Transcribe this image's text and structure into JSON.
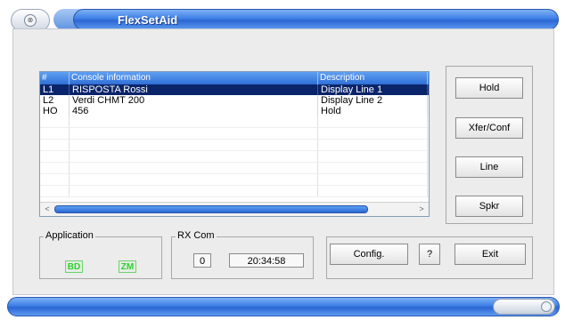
{
  "window": {
    "title": "FlexSetAid"
  },
  "list": {
    "columns": [
      "#",
      "Console information",
      "Description"
    ],
    "rows": [
      {
        "id": "L1",
        "info": "RISPOSTA Rossi",
        "desc": "Display Line 1",
        "selected": true
      },
      {
        "id": "L2",
        "info": "Verdi CHMT 200",
        "desc": "Display Line 2",
        "selected": false
      },
      {
        "id": "HO",
        "info": "456",
        "desc": "Hold",
        "selected": false
      }
    ]
  },
  "buttons": {
    "hold": "Hold",
    "xfer": "Xfer/Conf",
    "line": "Line",
    "spkr": "Spkr",
    "config": "Config.",
    "help": "?",
    "exit": "Exit"
  },
  "application": {
    "label": "Application",
    "led1": "BD",
    "led2": "ZM"
  },
  "rxcom": {
    "label": "RX Com",
    "count": "0",
    "time": "20:34:58"
  },
  "colors": {
    "accent": "#2f6fd6",
    "selection": "#0a246a",
    "led": "#2bd12b"
  }
}
